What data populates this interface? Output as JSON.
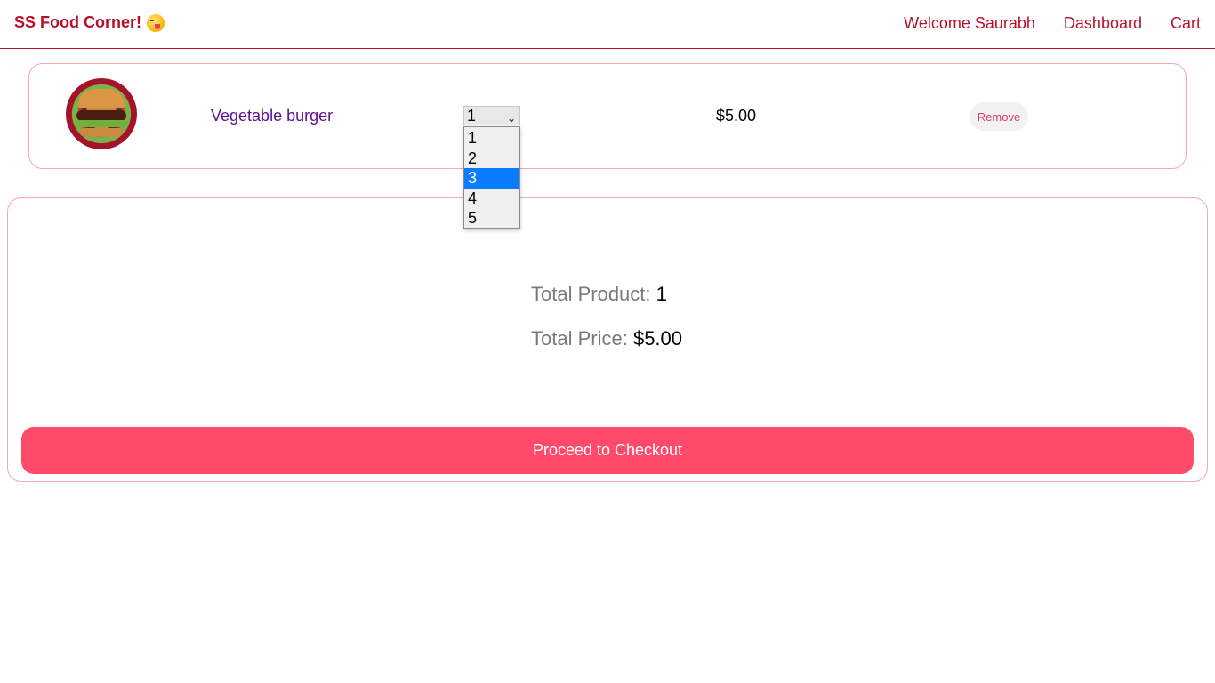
{
  "header": {
    "brand": "SS Food Corner!",
    "brand_emoji_icon": "face-savoring-food-emoji",
    "links": [
      "Welcome Saurabh",
      "Dashboard",
      "Cart"
    ]
  },
  "cart": {
    "items": [
      {
        "image_icon": "burger-photo",
        "name": "Vegetable burger",
        "quantity": "1",
        "price": "$5.00",
        "remove_label": "Remove"
      }
    ]
  },
  "quantity_dropdown": {
    "options": [
      "1",
      "2",
      "3",
      "4",
      "5"
    ],
    "highlighted": "3"
  },
  "summary": {
    "total_product_label": "Total Product:",
    "total_product_value": "1",
    "total_price_label": "Total Price:",
    "total_price_value": "$5.00",
    "checkout_label": "Proceed to Checkout"
  },
  "colors": {
    "brand": "#b8102a",
    "card_border": "#f4a9b4",
    "item_name": "#5a0f8f",
    "checkout_bg": "#ff4a6a",
    "dropdown_highlight": "#0a7cff"
  }
}
